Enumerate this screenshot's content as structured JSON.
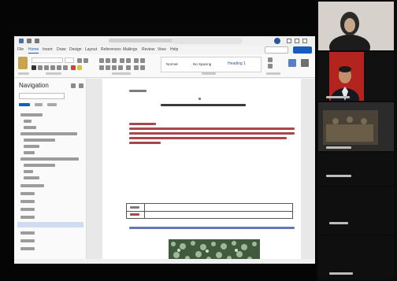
{
  "window": {
    "accent": "#185abd",
    "ribbon_tabs": [
      "File",
      "Home",
      "Insert",
      "Draw",
      "Design",
      "Layout",
      "References",
      "Mailings",
      "Review",
      "View",
      "Help"
    ]
  },
  "styles": {
    "normal": "Normal",
    "no_spacing": "No Spacing",
    "heading1": "Heading 1"
  },
  "navigation": {
    "title": "Navigation"
  },
  "icons": {
    "save": "save-icon",
    "undo": "undo-icon",
    "redo": "redo-icon",
    "search": "search-icon",
    "paste": "paste-icon",
    "account": "account-icon"
  },
  "participants": [
    {
      "label": ""
    },
    {
      "label": ""
    },
    {
      "label": ""
    },
    {
      "label": ""
    },
    {
      "label": ""
    },
    {
      "label": ""
    }
  ]
}
